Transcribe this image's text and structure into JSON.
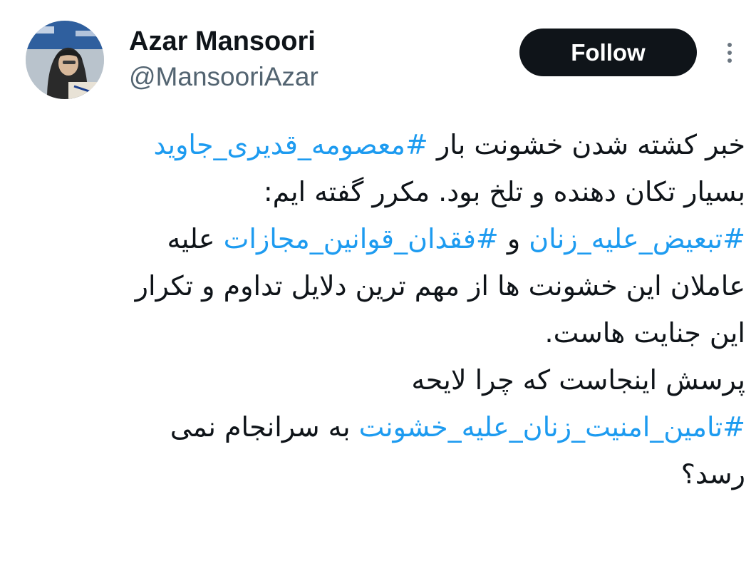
{
  "author": {
    "display_name": "Azar Mansoori",
    "handle": "@MansooriAzar",
    "follow_label": "Follow",
    "more_icon": "more-vertical-icon"
  },
  "tweet": {
    "line1": {
      "text": "خبر کشته شدن خشونت بار ",
      "hashtag": "#معصومه_قدیری_جاوید"
    },
    "line2": {
      "text": "بسیار تکان دهنده و تلخ بود. مکرر گفته ایم:"
    },
    "line3": {
      "hashtag1": "#تبعیض_علیه_زنان",
      "middle": " و ",
      "hashtag2": "#فقدان_قوانین_مجازات",
      "end": " علیه"
    },
    "line4": {
      "text": "عاملان این خشونت ها از مهم ترین دلایل تداوم و تکرار"
    },
    "line5": {
      "text": "این جنایت هاست."
    },
    "line6": {
      "text": "پرسش اینجاست که چرا لایحه"
    },
    "line7": {
      "hashtag": "#تامین_امنیت_زنان_علیه_خشونت",
      "text": " به سرانجام نمی"
    },
    "line8": {
      "text": "رسد؟"
    }
  },
  "colors": {
    "text": "#0f1419",
    "secondary": "#536471",
    "hashtag": "#1d9bf0",
    "button_bg": "#0f1419",
    "button_text": "#ffffff"
  }
}
